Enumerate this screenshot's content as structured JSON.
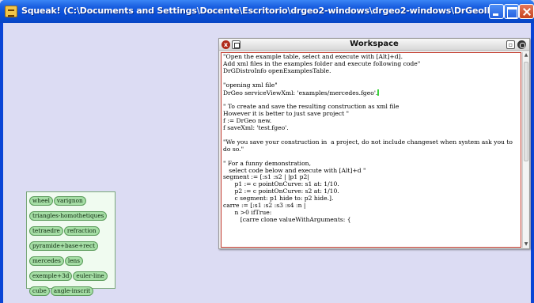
{
  "window": {
    "title": "Squeak! (C:\\Documents and Settings\\Docente\\Escritorio\\drgeo2-windows\\drgeo2-windows\\DrGeoII.image)"
  },
  "workspace": {
    "title": "Workspace",
    "text": "\"Open the example table, select and execute with [Alt]+d].\nAdd xml files in the examples folder and execute following code\"\nDrGDistroInfo openExamplesTable.\n\n\"opening xml file\"\nDrGeo serviceViewXml: 'examples/mercedes.fgeo'.",
    "text_after_cursor": "\n\n\" To create and save the resulting construction as xml file\nHowever it is better to just save project \"\nf := DrGeo new.\nf saveXml: 'test.fgeo'.\n\n\"We you save your construction in  a project, do not include changeset when system ask you to do so.\"\n\n\" For a funny demonstration,\n   select code below and execute with [Alt]+d \"\nsegment := [:s1 :s2 | |p1 p2|\n      p1 := c pointOnCurve: s1 at: 1/10.\n      p2 := c pointOnCurve: s2 at: 1/10.\n      c segment: p1 hide to: p2 hide.].\ncarre := [:s1 :s2 :s3 :s4 :n |\n      n >0 ifTrue:\n         [carre clone valueWithArguments: {"
  },
  "palette": {
    "items": [
      "wheel",
      "varignon",
      "triangles-homothetiques",
      "tetraedre",
      "refraction",
      "pyramide+base+rect",
      "mercedes",
      "lens",
      "exemple+3d",
      "euler-line",
      "cube",
      "angle-inscrit"
    ]
  },
  "colors": {
    "titlebar": "#0a4fd8",
    "desktop": "#dcdcf3",
    "chip": "#a5dda5",
    "text_border": "#c33b2e"
  }
}
